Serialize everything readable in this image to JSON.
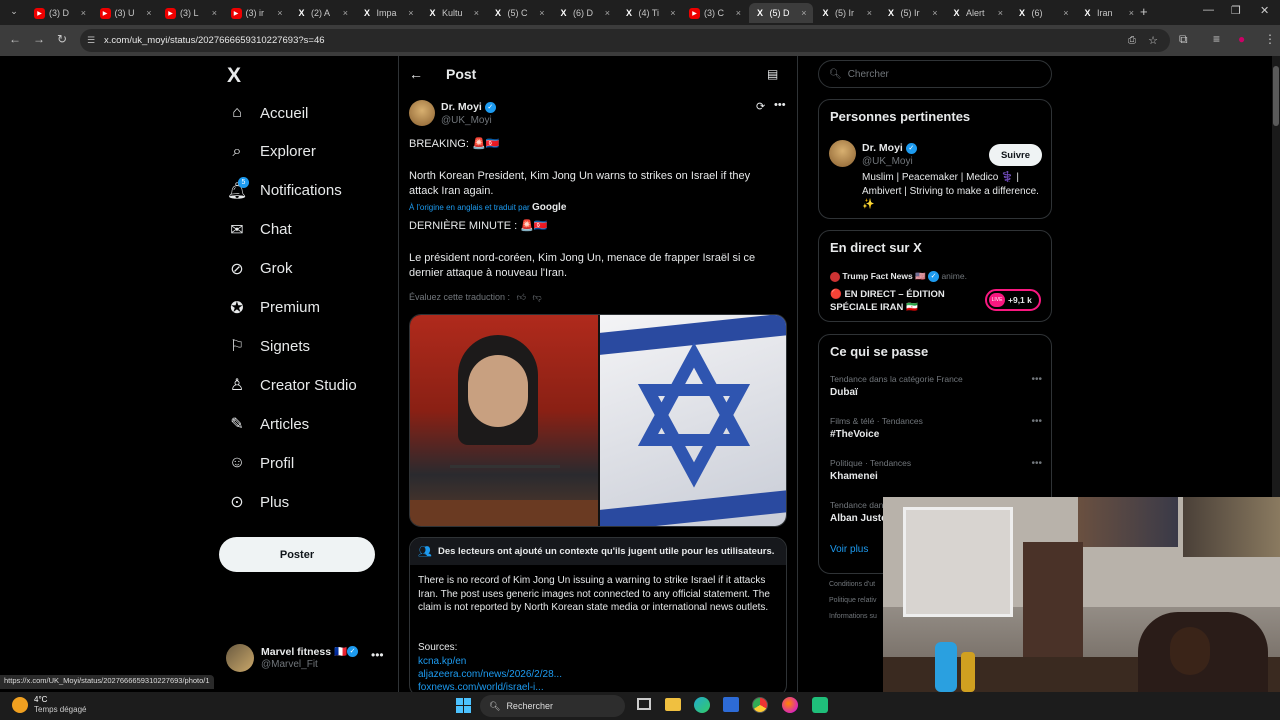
{
  "browser": {
    "tabs": [
      {
        "icon": "youtube",
        "label": "(3) D"
      },
      {
        "icon": "youtube",
        "label": "(3) U"
      },
      {
        "icon": "youtube",
        "label": "(3) L"
      },
      {
        "icon": "youtube",
        "label": "(3) ir"
      },
      {
        "icon": "x",
        "label": "(2) A"
      },
      {
        "icon": "x",
        "label": "Impa"
      },
      {
        "icon": "x",
        "label": "Kultu"
      },
      {
        "icon": "x",
        "label": "(5) C"
      },
      {
        "icon": "x",
        "label": "(6) D"
      },
      {
        "icon": "x",
        "label": "(4) Ti"
      },
      {
        "icon": "youtube",
        "label": "(3) C"
      },
      {
        "icon": "x",
        "label": "(5) D",
        "active": true
      },
      {
        "icon": "x",
        "label": "(5) Ir"
      },
      {
        "icon": "x",
        "label": "(5) Ir"
      },
      {
        "icon": "x",
        "label": "Alert"
      },
      {
        "icon": "x",
        "label": "(6)"
      },
      {
        "icon": "x",
        "label": "Iran"
      }
    ],
    "url": "x.com/uk_moyi/status/2027666659310227693?s=46",
    "status_url": "https://x.com/UK_Moyi/status/2027666659310227693/photo/1"
  },
  "sidebar": {
    "logo": "X",
    "items": [
      {
        "label": "Accueil",
        "icon": "home-icon"
      },
      {
        "label": "Explorer",
        "icon": "search-icon"
      },
      {
        "label": "Notifications",
        "icon": "bell-icon",
        "badge": "5"
      },
      {
        "label": "Chat",
        "icon": "mail-icon"
      },
      {
        "label": "Grok",
        "icon": "grok-icon"
      },
      {
        "label": "Premium",
        "icon": "premium-icon"
      },
      {
        "label": "Signets",
        "icon": "bookmark-icon"
      },
      {
        "label": "Creator Studio",
        "icon": "creator-icon"
      },
      {
        "label": "Articles",
        "icon": "articles-icon"
      },
      {
        "label": "Profil",
        "icon": "profile-icon"
      },
      {
        "label": "Plus",
        "icon": "more-icon"
      }
    ],
    "post_button": "Poster",
    "account": {
      "name": "Marvel fitness 🇫🇷",
      "handle": "@Marvel_Fit"
    }
  },
  "post": {
    "header_title": "Post",
    "author_name": "Dr. Moyi",
    "author_handle": "@UK_Moyi",
    "breaking": "BREAKING: 🚨🇰🇵",
    "body": "North Korean President, Kim Jong Un warns to strikes on Israel if they attack Iran again.",
    "translated_by": "À l'origine en anglais et traduit par",
    "translator": "Google",
    "breaking_fr": "DERNIÈRE MINUTE : 🚨🇰🇵",
    "body_fr": "Le président nord-coréen, Kim Jong Un, menace de frapper Israël si ce dernier attaque à nouveau l'Iran.",
    "rate_translation": "Évaluez cette traduction :",
    "community_note": {
      "title": "Des lecteurs ont ajouté un contexte qu'ils jugent utile pour les utilisateurs.",
      "body": "There is no record of Kim Jong Un issuing a warning to strike Israel if it attacks Iran. The post uses generic images not connected to any official statement. The claim is not reported by North Korean state media or international news outlets.",
      "sources_label": "Sources:",
      "sources": [
        "kcna.kp/en",
        "aljazeera.com/news/2026/2/28...",
        "foxnews.com/world/israel-i..."
      ]
    }
  },
  "right": {
    "search_placeholder": "Chercher",
    "relevant": {
      "title": "Personnes pertinentes",
      "name": "Dr. Moyi",
      "handle": "@UK_Moyi",
      "follow": "Suivre",
      "bio": "Muslim | Peacemaker | Medico ⚕️ | Ambivert | Striving to make a difference. ✨"
    },
    "live": {
      "title": "En direct sur X",
      "host": "Trump Fact News 🇺🇸",
      "host_suffix": "anime.",
      "live_title": "🔴 EN DIRECT – ÉDITION SPÉCIALE IRAN 🇮🇷",
      "listeners": "+9,1 k"
    },
    "trends": {
      "title": "Ce qui se passe",
      "items": [
        {
          "context": "Tendance dans la catégorie France",
          "name": "Dubaï"
        },
        {
          "context": "Films & télé · Tendances",
          "name": "#TheVoice"
        },
        {
          "context": "Politique · Tendances",
          "name": "Khamenei"
        },
        {
          "context": "Tendance dans",
          "name": "Alban Juste"
        }
      ],
      "show_more": "Voir plus"
    },
    "footer": [
      "Conditions d'ut",
      "Politique relativ",
      "Informations su"
    ]
  },
  "taskbar": {
    "weather_temp": "4°C",
    "weather_desc": "Temps dégagé",
    "search": "Rechercher"
  },
  "colors": {
    "accent": "#1d9bf0",
    "background": "#000000",
    "border": "#2f3336"
  }
}
